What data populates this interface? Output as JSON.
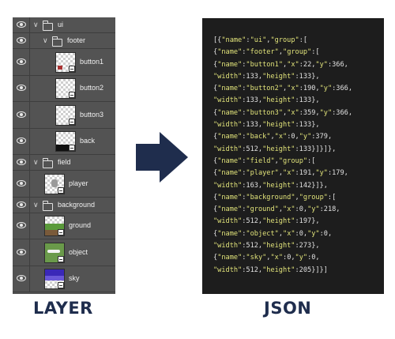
{
  "colors": {
    "navy": "#1f2d4d",
    "panel": "#535353",
    "json_bg": "#1d1d1d",
    "json_string": "#e1e37a"
  },
  "layers": [
    {
      "name": "ui",
      "kind": "group",
      "depth": 0,
      "icon": "folder-icon"
    },
    {
      "name": "footer",
      "kind": "group",
      "depth": 1,
      "icon": "folder-icon"
    },
    {
      "name": "button1",
      "kind": "layer",
      "depth": 2,
      "thumb": "button1"
    },
    {
      "name": "button2",
      "kind": "layer",
      "depth": 2,
      "thumb": "button2"
    },
    {
      "name": "button3",
      "kind": "layer",
      "depth": 2,
      "thumb": "button3"
    },
    {
      "name": "back",
      "kind": "layer",
      "depth": 2,
      "thumb": "back"
    },
    {
      "name": "field",
      "kind": "group",
      "depth": 0,
      "icon": "folder-icon"
    },
    {
      "name": "player",
      "kind": "layer",
      "depth": 1,
      "thumb": "player"
    },
    {
      "name": "background",
      "kind": "group",
      "depth": 0,
      "icon": "folder-icon"
    },
    {
      "name": "ground",
      "kind": "layer",
      "depth": 1,
      "thumb": "ground"
    },
    {
      "name": "object",
      "kind": "layer",
      "depth": 1,
      "thumb": "object"
    },
    {
      "name": "sky",
      "kind": "layer",
      "depth": 1,
      "thumb": "sky"
    }
  ],
  "json_lines": [
    [
      [
        "[{",
        "p"
      ],
      [
        "\"name\"",
        "s"
      ],
      [
        ":",
        "p"
      ],
      [
        "\"ui\"",
        "s"
      ],
      [
        ",",
        "p"
      ],
      [
        "\"group\"",
        "s"
      ],
      [
        ":[",
        "p"
      ]
    ],
    [
      [
        "{",
        "p"
      ],
      [
        "\"name\"",
        "s"
      ],
      [
        ":",
        "p"
      ],
      [
        "\"footer\"",
        "s"
      ],
      [
        ",",
        "p"
      ],
      [
        "\"group\"",
        "s"
      ],
      [
        ":[",
        "p"
      ]
    ],
    [
      [
        "{",
        "p"
      ],
      [
        "\"name\"",
        "s"
      ],
      [
        ":",
        "p"
      ],
      [
        "\"button1\"",
        "s"
      ],
      [
        ",",
        "p"
      ],
      [
        "\"x\"",
        "s"
      ],
      [
        ":22,",
        "p"
      ],
      [
        "\"y\"",
        "s"
      ],
      [
        ":366,",
        "p"
      ]
    ],
    [
      [
        "\"width\"",
        "s"
      ],
      [
        ":133,",
        "p"
      ],
      [
        "\"height\"",
        "s"
      ],
      [
        ":133},",
        "p"
      ]
    ],
    [
      [
        "{",
        "p"
      ],
      [
        "\"name\"",
        "s"
      ],
      [
        ":",
        "p"
      ],
      [
        "\"button2\"",
        "s"
      ],
      [
        ",",
        "p"
      ],
      [
        "\"x\"",
        "s"
      ],
      [
        ":190,",
        "p"
      ],
      [
        "\"y\"",
        "s"
      ],
      [
        ":366,",
        "p"
      ]
    ],
    [
      [
        "\"width\"",
        "s"
      ],
      [
        ":133,",
        "p"
      ],
      [
        "\"height\"",
        "s"
      ],
      [
        ":133},",
        "p"
      ]
    ],
    [
      [
        "{",
        "p"
      ],
      [
        "\"name\"",
        "s"
      ],
      [
        ":",
        "p"
      ],
      [
        "\"button3\"",
        "s"
      ],
      [
        ",",
        "p"
      ],
      [
        "\"x\"",
        "s"
      ],
      [
        ":359,",
        "p"
      ],
      [
        "\"y\"",
        "s"
      ],
      [
        ":366,",
        "p"
      ]
    ],
    [
      [
        "\"width\"",
        "s"
      ],
      [
        ":133,",
        "p"
      ],
      [
        "\"height\"",
        "s"
      ],
      [
        ":133},",
        "p"
      ]
    ],
    [
      [
        "{",
        "p"
      ],
      [
        "\"name\"",
        "s"
      ],
      [
        ":",
        "p"
      ],
      [
        "\"back\"",
        "s"
      ],
      [
        ",",
        "p"
      ],
      [
        "\"x\"",
        "s"
      ],
      [
        ":0,",
        "p"
      ],
      [
        "\"y\"",
        "s"
      ],
      [
        ":379,",
        "p"
      ]
    ],
    [
      [
        "\"width\"",
        "s"
      ],
      [
        ":512,",
        "p"
      ],
      [
        "\"height\"",
        "s"
      ],
      [
        ":133}]}]},",
        "p"
      ]
    ],
    [
      [
        "{",
        "p"
      ],
      [
        "\"name\"",
        "s"
      ],
      [
        ":",
        "p"
      ],
      [
        "\"field\"",
        "s"
      ],
      [
        ",",
        "p"
      ],
      [
        "\"group\"",
        "s"
      ],
      [
        ":[",
        "p"
      ]
    ],
    [
      [
        "{",
        "p"
      ],
      [
        "\"name\"",
        "s"
      ],
      [
        ":",
        "p"
      ],
      [
        "\"player\"",
        "s"
      ],
      [
        ",",
        "p"
      ],
      [
        "\"x\"",
        "s"
      ],
      [
        ":191,",
        "p"
      ],
      [
        "\"y\"",
        "s"
      ],
      [
        ":179,",
        "p"
      ]
    ],
    [
      [
        "\"width\"",
        "s"
      ],
      [
        ":163,",
        "p"
      ],
      [
        "\"height\"",
        "s"
      ],
      [
        ":142}]},",
        "p"
      ]
    ],
    [
      [
        "{",
        "p"
      ],
      [
        "\"name\"",
        "s"
      ],
      [
        ":",
        "p"
      ],
      [
        "\"background\"",
        "s"
      ],
      [
        ",",
        "p"
      ],
      [
        "\"group\"",
        "s"
      ],
      [
        ":[",
        "p"
      ]
    ],
    [
      [
        "{",
        "p"
      ],
      [
        "\"name\"",
        "s"
      ],
      [
        ":",
        "p"
      ],
      [
        "\"ground\"",
        "s"
      ],
      [
        ",",
        "p"
      ],
      [
        "\"x\"",
        "s"
      ],
      [
        ":0,",
        "p"
      ],
      [
        "\"y\"",
        "s"
      ],
      [
        ":218,",
        "p"
      ]
    ],
    [
      [
        "\"width\"",
        "s"
      ],
      [
        ":512,",
        "p"
      ],
      [
        "\"height\"",
        "s"
      ],
      [
        ":197},",
        "p"
      ]
    ],
    [
      [
        "{",
        "p"
      ],
      [
        "\"name\"",
        "s"
      ],
      [
        ":",
        "p"
      ],
      [
        "\"object\"",
        "s"
      ],
      [
        ",",
        "p"
      ],
      [
        "\"x\"",
        "s"
      ],
      [
        ":0,",
        "p"
      ],
      [
        "\"y\"",
        "s"
      ],
      [
        ":0,",
        "p"
      ]
    ],
    [
      [
        "\"width\"",
        "s"
      ],
      [
        ":512,",
        "p"
      ],
      [
        "\"height\"",
        "s"
      ],
      [
        ":273},",
        "p"
      ]
    ],
    [
      [
        "{",
        "p"
      ],
      [
        "\"name\"",
        "s"
      ],
      [
        ":",
        "p"
      ],
      [
        "\"sky\"",
        "s"
      ],
      [
        ",",
        "p"
      ],
      [
        "\"x\"",
        "s"
      ],
      [
        ":0,",
        "p"
      ],
      [
        "\"y\"",
        "s"
      ],
      [
        ":0,",
        "p"
      ]
    ],
    [
      [
        "\"width\"",
        "s"
      ],
      [
        ":512,",
        "p"
      ],
      [
        "\"height\"",
        "s"
      ],
      [
        ":205}]}]",
        "p"
      ]
    ]
  ],
  "captions": {
    "left": "LAYER",
    "right": "JSON"
  },
  "arrow_icon": "right-arrow-icon"
}
